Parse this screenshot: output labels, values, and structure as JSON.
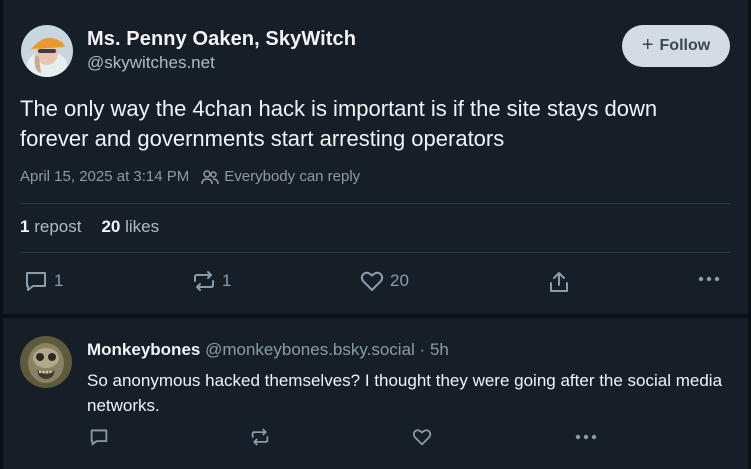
{
  "post": {
    "author_name": "Ms. Penny Oaken, SkyWitch",
    "author_handle": "@skywitches.net",
    "follow_label": "Follow",
    "text": "The only way the 4chan hack is important is if the site stays down forever and governments start arresting operators",
    "timestamp": "April 15, 2025 at 3:14 PM",
    "reply_setting": "Everybody can reply",
    "stats": {
      "reposts_count": "1",
      "reposts_label": "repost",
      "likes_count": "20",
      "likes_label": "likes"
    },
    "actions": {
      "replies": "1",
      "reposts": "1",
      "likes": "20"
    },
    "icons": [
      "avatar",
      "plus-icon",
      "people-icon",
      "comment-icon",
      "repost-icon",
      "heart-icon",
      "share-icon",
      "more-icon"
    ]
  },
  "reply": {
    "author_name": "Monkeybones",
    "author_handle": "@monkeybones.bsky.social",
    "separator": "·",
    "age": "5h",
    "text": "So anonymous hacked themselves? I thought they were going after the social media networks."
  },
  "colors": {
    "background": "#161e27",
    "text": "#f1f3f5",
    "muted": "#8c9baa",
    "follow_button": "#d4dbe2"
  }
}
